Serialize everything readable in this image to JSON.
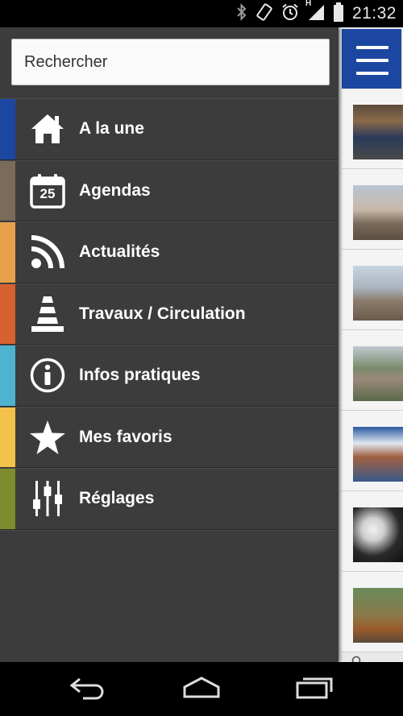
{
  "status_bar": {
    "time": "21:32",
    "network_type": "H",
    "icons": [
      "bluetooth-icon",
      "rotation-lock-icon",
      "alarm-icon",
      "signal-icon",
      "battery-icon"
    ]
  },
  "drawer": {
    "search": {
      "placeholder": "Rechercher"
    },
    "items": [
      {
        "label": "A la une",
        "icon": "home-icon",
        "color": "#1c47a1"
      },
      {
        "label": "Agendas",
        "icon": "calendar-icon",
        "calendar_day": "25",
        "color": "#7a6b5b"
      },
      {
        "label": "Actualités",
        "icon": "rss-icon",
        "color": "#e9a04a"
      },
      {
        "label": "Travaux / Circulation",
        "icon": "traffic-cone-icon",
        "color": "#d8622e"
      },
      {
        "label": "Infos pratiques",
        "icon": "info-icon",
        "color": "#4fb3cf"
      },
      {
        "label": "Mes favoris",
        "icon": "star-icon",
        "color": "#f2c24a"
      },
      {
        "label": "Réglages",
        "icon": "sliders-icon",
        "color": "#7d8d2c"
      }
    ]
  },
  "background_app": {
    "header_color": "#1c47a1",
    "feed_count": 7
  },
  "nav_bar": {
    "buttons": [
      "back-button",
      "home-button",
      "recent-apps-button"
    ]
  }
}
